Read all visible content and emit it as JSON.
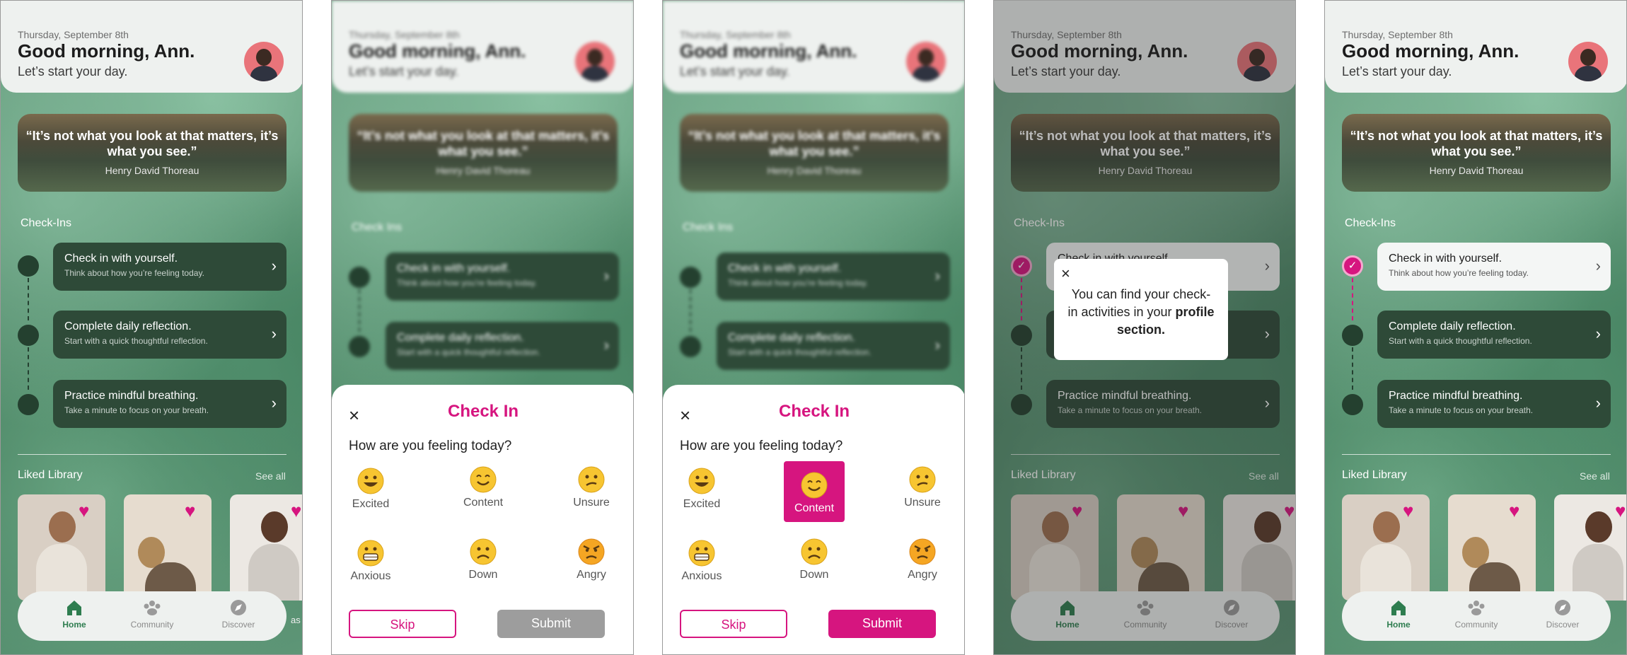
{
  "colors": {
    "accent": "#d6157f",
    "active_nav": "#2e7d4f",
    "node_dark": "#24402f",
    "task_bg": "#2e4a38",
    "disabled": "#9d9d9d"
  },
  "home": {
    "date": "Thursday, September 8th",
    "greeting": "Good morning, Ann.",
    "subtitle": "Let’s start your day.",
    "quote_text": "“It’s not what you look at that matters, it’s what you see.”",
    "quote_author": "Henry David Thoreau",
    "checkins_title": "Check-Ins",
    "tasks": [
      {
        "title": "Check in with yourself.",
        "subtitle": "Think about how you’re feeling today."
      },
      {
        "title": "Complete daily reflection.",
        "subtitle": "Start with a quick thoughtful reflection."
      },
      {
        "title": "Practice mindful breathing.",
        "subtitle": "Take a minute to focus on your breath."
      }
    ],
    "liked_title": "Liked Library",
    "see_all": "See all",
    "card_caption_partial": "as",
    "nav": [
      {
        "label": "Home",
        "icon": "home-icon"
      },
      {
        "label": "Community",
        "icon": "community-icon"
      },
      {
        "label": "Discover",
        "icon": "compass-icon"
      }
    ]
  },
  "blurred_home": {
    "checkins_title": "Check Ins"
  },
  "checkin_sheet": {
    "title": "Check In",
    "question": "How are you feeling today?",
    "moods": [
      {
        "label": "Excited",
        "icon": "grinning-face-icon"
      },
      {
        "label": "Content",
        "icon": "smiling-face-icon"
      },
      {
        "label": "Unsure",
        "icon": "confused-face-icon"
      },
      {
        "label": "Anxious",
        "icon": "grimacing-face-icon"
      },
      {
        "label": "Down",
        "icon": "frowning-face-icon"
      },
      {
        "label": "Angry",
        "icon": "angry-face-icon"
      }
    ],
    "selected_mood_screen3": "Content",
    "skip_label": "Skip",
    "submit_label": "Submit"
  },
  "tooltip": {
    "text": "You can find your check-in activities in your",
    "strong": "profile section."
  }
}
